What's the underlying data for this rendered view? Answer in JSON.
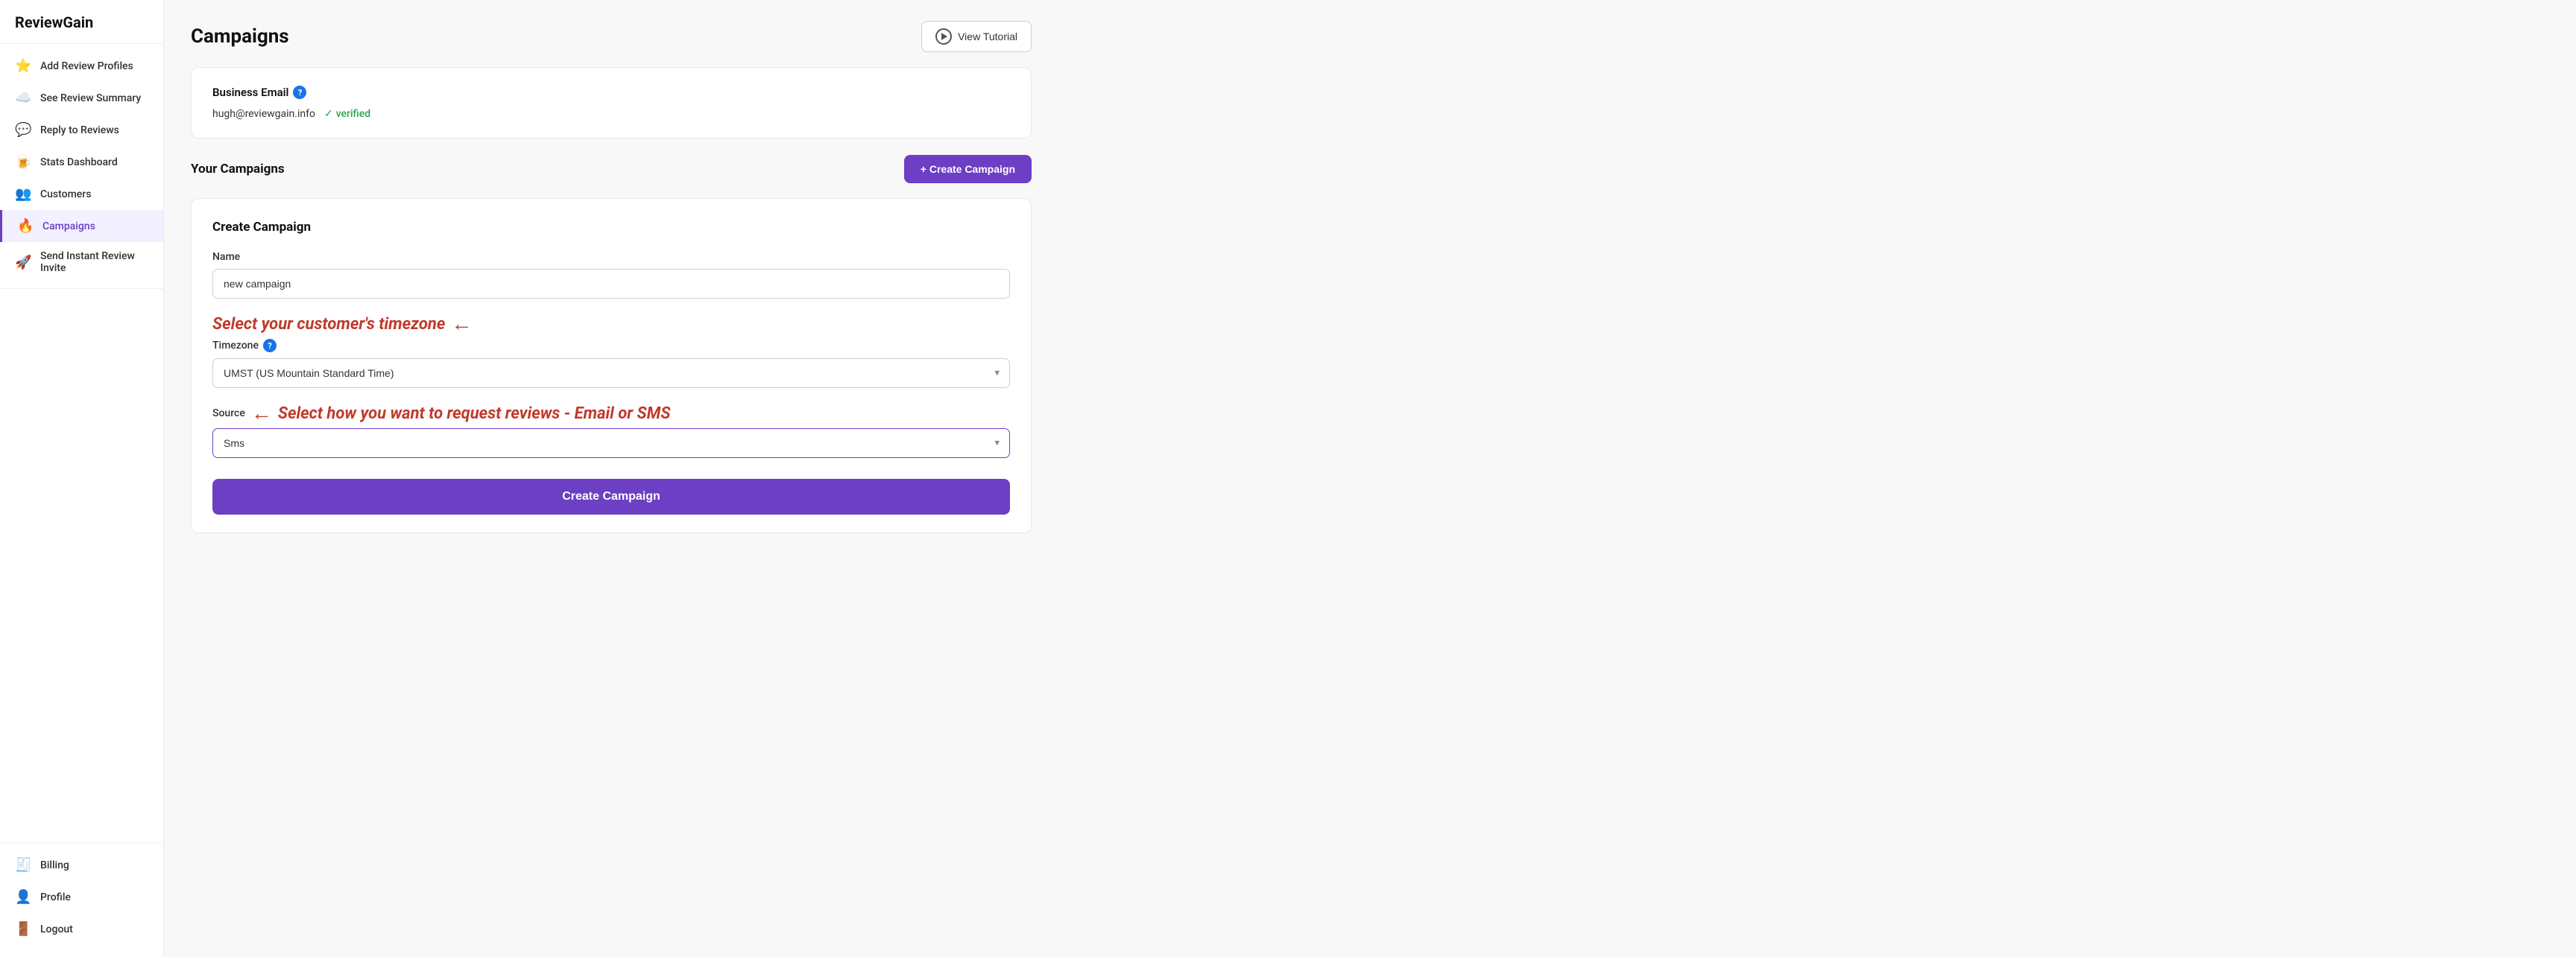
{
  "app": {
    "logo": "ReviewGain"
  },
  "sidebar": {
    "items": [
      {
        "id": "add-review-profiles",
        "label": "Add Review Profiles",
        "icon": "⭐",
        "active": false
      },
      {
        "id": "see-review-summary",
        "label": "See Review Summary",
        "icon": "☁️",
        "active": false
      },
      {
        "id": "reply-to-reviews",
        "label": "Reply to Reviews",
        "icon": "💬",
        "active": false
      },
      {
        "id": "stats-dashboard",
        "label": "Stats Dashboard",
        "icon": "🍺",
        "active": false
      },
      {
        "id": "customers",
        "label": "Customers",
        "icon": "👥",
        "active": false
      },
      {
        "id": "campaigns",
        "label": "Campaigns",
        "icon": "🔥",
        "active": true
      },
      {
        "id": "send-instant-review-invite",
        "label": "Send Instant Review Invite",
        "icon": "🚀",
        "active": false
      }
    ],
    "bottom_items": [
      {
        "id": "billing",
        "label": "Billing",
        "icon": "🧾"
      },
      {
        "id": "profile",
        "label": "Profile",
        "icon": "👤"
      },
      {
        "id": "logout",
        "label": "Logout",
        "icon": "🚪"
      }
    ]
  },
  "header": {
    "title": "Campaigns",
    "view_tutorial_label": "View Tutorial"
  },
  "business_email": {
    "label": "Business Email",
    "email": "hugh@reviewgain.info",
    "verified_text": "verified"
  },
  "campaigns_section": {
    "title": "Your Campaigns",
    "create_button_label": "+ Create Campaign"
  },
  "create_campaign_form": {
    "title": "Create Campaign",
    "name_label": "Name",
    "name_value": "new campaign",
    "timezone_label": "Timezone",
    "timezone_value": "UMST (US Mountain Standard Time)",
    "source_label": "Source",
    "source_value": "Sms",
    "annotation1_text": "Select your customer's timezone",
    "annotation2_text": "Select how you want to request reviews - Email or SMS",
    "submit_label": "Create Campaign"
  },
  "icons": {
    "info": "?",
    "check": "✓",
    "play": "▶",
    "arrow_down": "▾",
    "arrow_left": "←"
  }
}
